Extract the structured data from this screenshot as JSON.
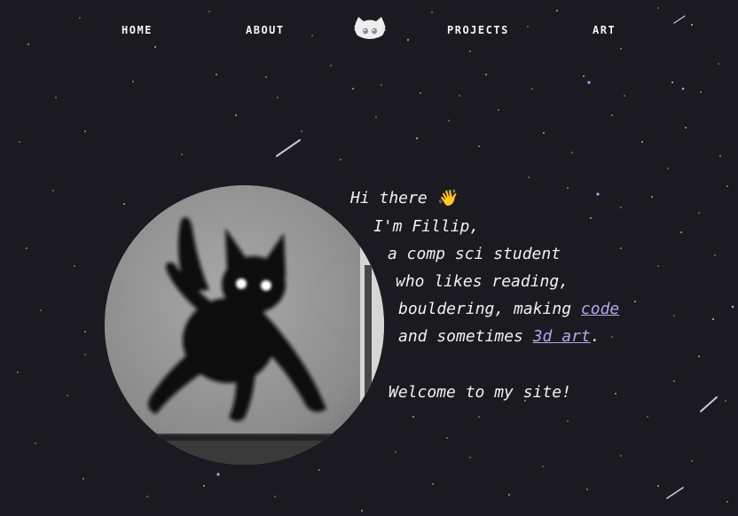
{
  "nav": {
    "home": "HOME",
    "about": "ABOUT",
    "projects": "PROJECTS",
    "art": "ART",
    "logo_icon": "cat-face-logo-icon"
  },
  "intro": {
    "greeting": "Hi there",
    "wave_icon": "👋",
    "name_line": "I'm Fillip,",
    "student_line": "a comp sci student",
    "likes_line": "who likes reading,",
    "bouldering_prefix": "bouldering, making ",
    "code_link": "code",
    "sometimes_prefix": "and sometimes ",
    "art_link": "3d art",
    "sometimes_suffix": ".",
    "welcome": "Welcome to my site!"
  },
  "avatar": {
    "icon": "black-cat-photo"
  },
  "colors": {
    "background": "#1b1a21",
    "text": "#f1f1f1",
    "link": "#b7a6ea"
  }
}
